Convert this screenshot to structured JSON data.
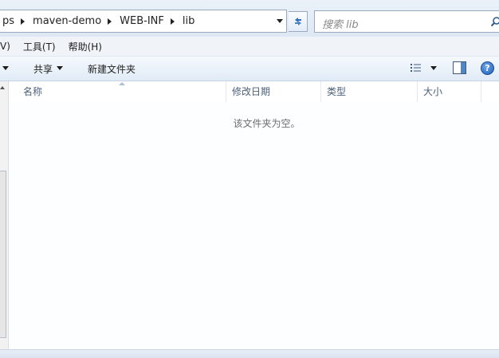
{
  "address": {
    "crumbs": [
      "ps",
      "maven-demo",
      "WEB-INF",
      "lib"
    ],
    "dropdown_icon": "chevron-down-icon",
    "refresh_icon": "refresh-icon"
  },
  "search": {
    "placeholder": "搜索 lib",
    "icon": "search-icon"
  },
  "menu": {
    "items": [
      "V)",
      "工具(T)",
      "帮助(H)"
    ]
  },
  "commands": {
    "share_label": "共享",
    "new_folder_label": "新建文件夹",
    "view_icon": "view-options-icon",
    "preview_pane_icon": "preview-pane-icon",
    "help_glyph": "?"
  },
  "columns": {
    "name": "名称",
    "modified": "修改日期",
    "type": "类型",
    "size": "大小"
  },
  "content": {
    "empty_message": "该文件夹为空。"
  },
  "colors": {
    "accent": "#1d5fb8",
    "header_text": "#4c607a",
    "toolbar_bg": "#e1ebf6"
  }
}
